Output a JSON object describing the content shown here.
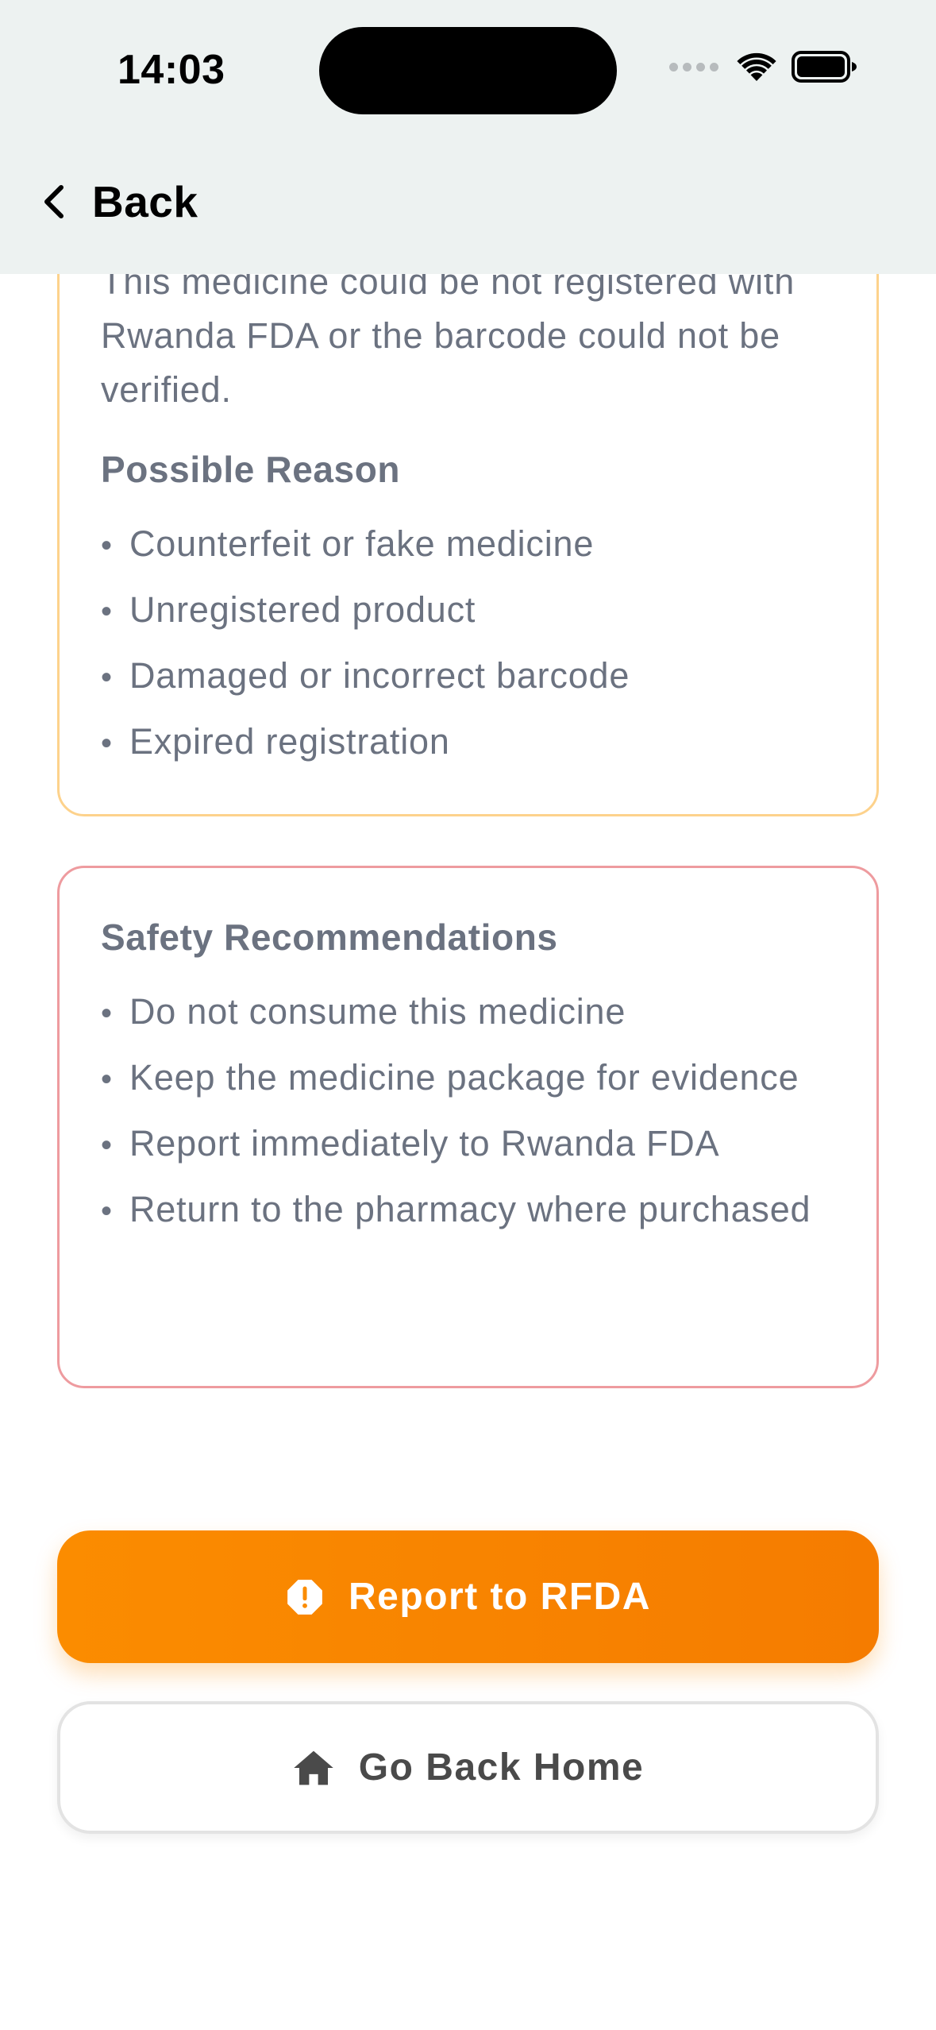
{
  "status_bar": {
    "time": "14:03"
  },
  "nav": {
    "back_label": "Back"
  },
  "warning_card": {
    "description": "This medicine could be not registered with Rwanda FDA or the barcode could not be verified.",
    "reasons_title": "Possible Reason",
    "reasons": [
      "Counterfeit or fake medicine",
      "Unregistered product",
      "Damaged or incorrect barcode",
      "Expired registration"
    ],
    "border_color": "#fdd28c"
  },
  "safety_card": {
    "title": "Safety Recommendations",
    "items": [
      "Do not consume this medicine",
      "Keep the medicine package for evidence",
      "Report immediately to Rwanda FDA",
      "Return to the pharmacy where purchased"
    ],
    "border_color": "#ee9b9f"
  },
  "actions": {
    "report_label": "Report to RFDA",
    "report_icon": "alert-octagon-icon",
    "home_label": "Go Back Home",
    "home_icon": "home-icon"
  },
  "colors": {
    "accent": "#fb8c00",
    "header_bg": "#edf2f1",
    "muted_text": "#6b7280"
  }
}
